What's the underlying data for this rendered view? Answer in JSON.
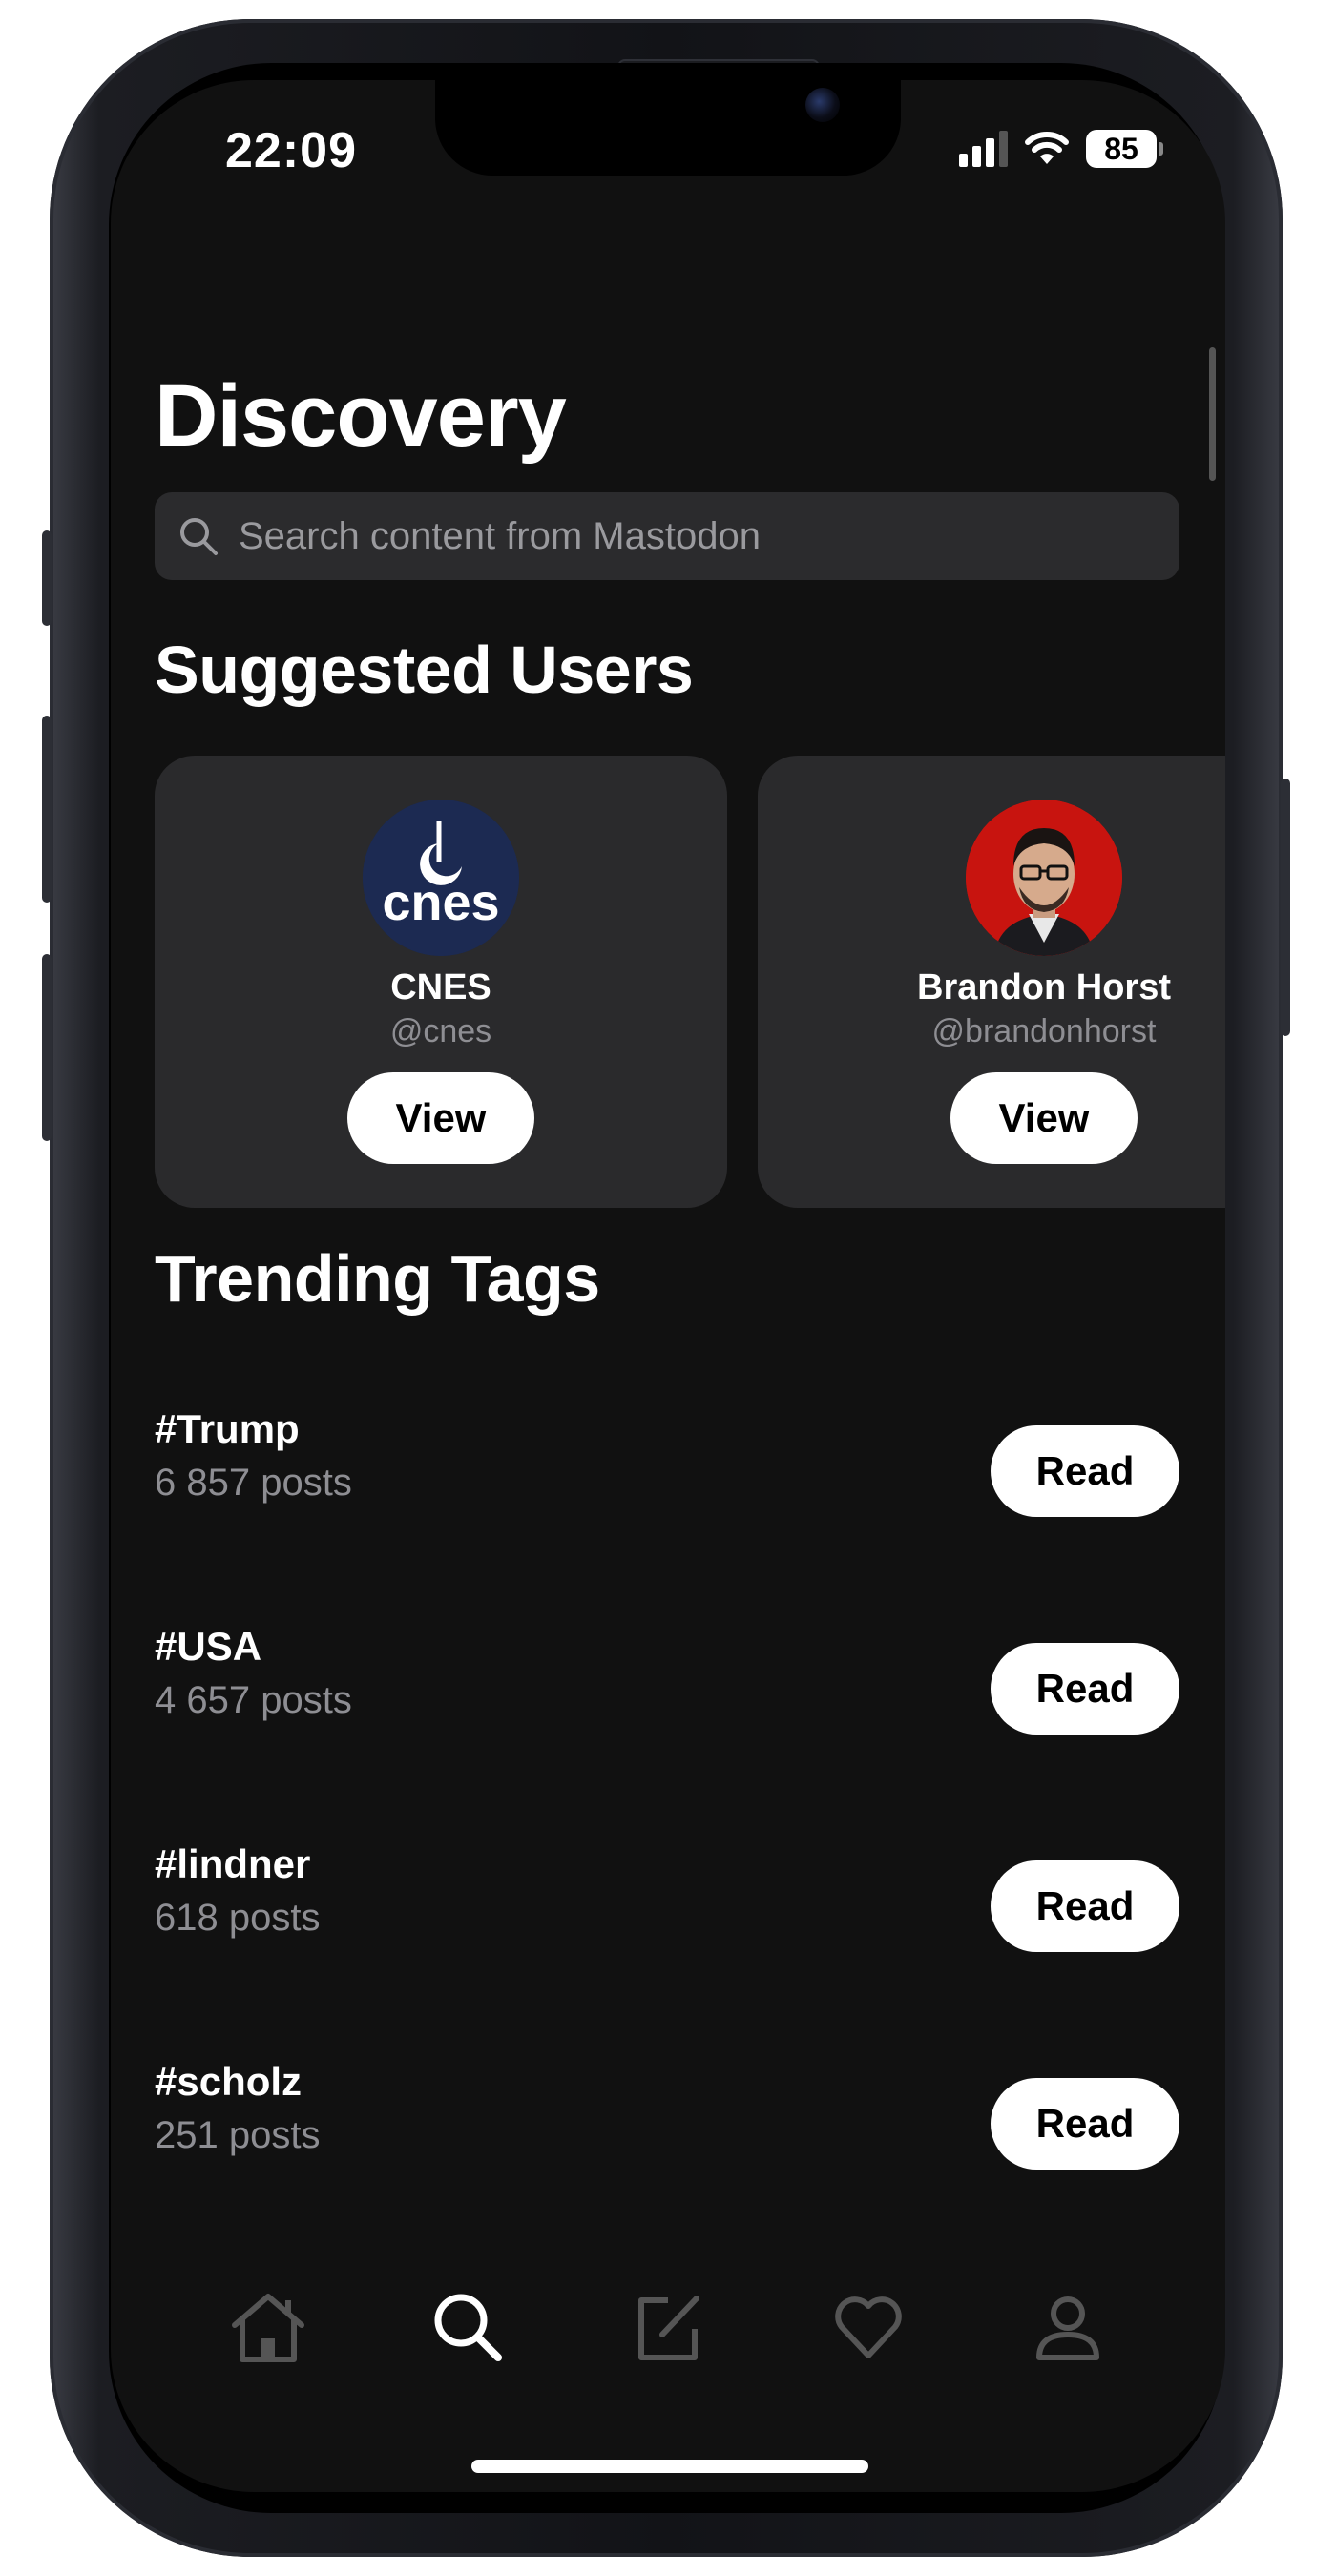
{
  "status_bar": {
    "time": "22:09",
    "battery": "85"
  },
  "page": {
    "title": "Discovery"
  },
  "search": {
    "placeholder": "Search content from Mastodon",
    "icon": "search-icon"
  },
  "suggested_users": {
    "heading": "Suggested Users",
    "users": [
      {
        "name": "CNES",
        "handle": "@cnes",
        "avatar_text": "cnes",
        "avatar_bg": "#1c2a52",
        "button_label": "View"
      },
      {
        "name": "Brandon Horst",
        "handle": "@brandonhorst",
        "avatar_bg": "#c8140f",
        "button_label": "View"
      }
    ]
  },
  "trending_tags": {
    "heading": "Trending Tags",
    "tags": [
      {
        "tag": "#Trump",
        "count": "6 857 posts",
        "button_label": "Read"
      },
      {
        "tag": "#USA",
        "count": "4 657 posts",
        "button_label": "Read"
      },
      {
        "tag": "#lindner",
        "count": "618 posts",
        "button_label": "Read"
      },
      {
        "tag": "#scholz",
        "count": "251 posts",
        "button_label": "Read"
      }
    ]
  },
  "tab_bar": {
    "tabs": [
      {
        "icon": "home-icon",
        "active": false
      },
      {
        "icon": "search-icon",
        "active": true
      },
      {
        "icon": "compose-icon",
        "active": false
      },
      {
        "icon": "heart-icon",
        "active": false
      },
      {
        "icon": "profile-icon",
        "active": false
      }
    ]
  },
  "colors": {
    "background": "#111111",
    "card": "#2a2a2c",
    "muted_text": "#8e8e93",
    "button_bg": "#ffffff"
  }
}
